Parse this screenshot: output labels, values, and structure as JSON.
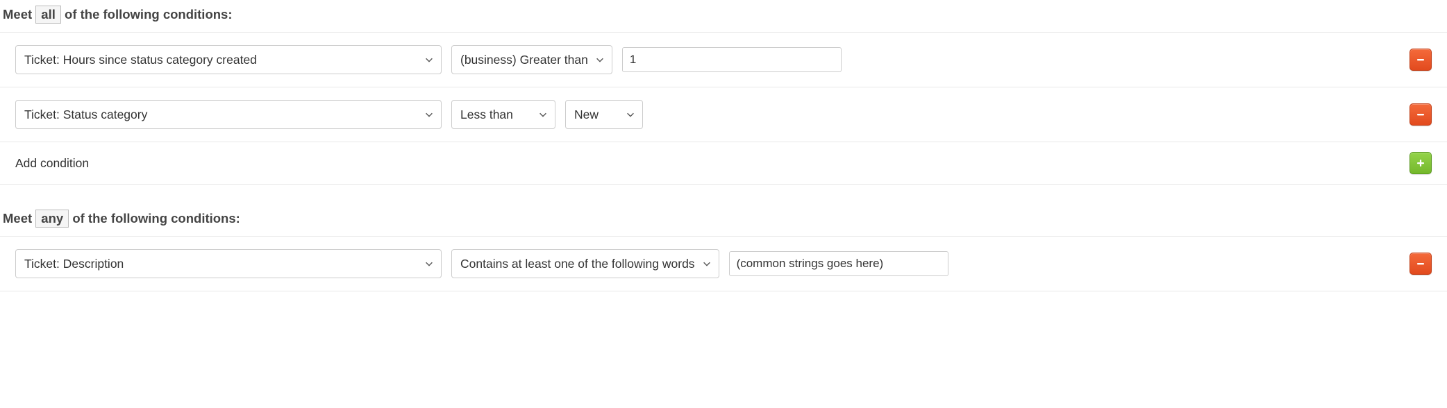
{
  "sections": {
    "all": {
      "header_pre": "Meet ",
      "header_quant": "all",
      "header_post": " of the following conditions:",
      "rows": [
        {
          "field": "Ticket: Hours since status category created",
          "operator": "(business) Greater than",
          "value": "1"
        },
        {
          "field": "Ticket: Status category",
          "operator": "Less than",
          "value_select": "New"
        }
      ],
      "add_label": "Add condition"
    },
    "any": {
      "header_pre": "Meet ",
      "header_quant": "any",
      "header_post": " of the following conditions:",
      "rows": [
        {
          "field": "Ticket: Description",
          "operator": "Contains at least one of the following words",
          "value": "(common strings goes here)"
        }
      ]
    }
  }
}
